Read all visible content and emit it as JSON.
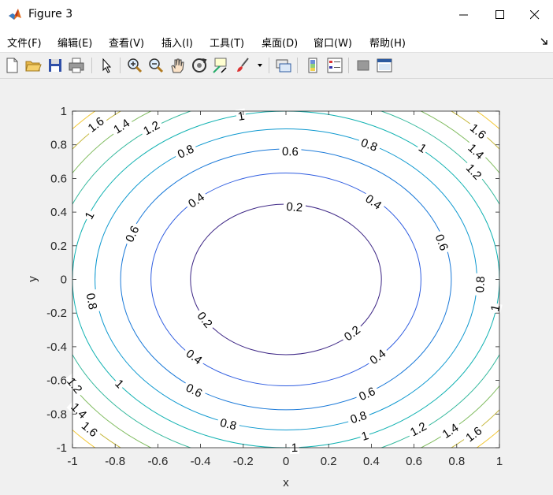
{
  "window": {
    "title": "Figure 3"
  },
  "menu": [
    {
      "label": "文件(F)",
      "name": "menu-file"
    },
    {
      "label": "编辑(E)",
      "name": "menu-edit"
    },
    {
      "label": "查看(V)",
      "name": "menu-view"
    },
    {
      "label": "插入(I)",
      "name": "menu-insert"
    },
    {
      "label": "工具(T)",
      "name": "menu-tools"
    },
    {
      "label": "桌面(D)",
      "name": "menu-desktop"
    },
    {
      "label": "窗口(W)",
      "name": "menu-window"
    },
    {
      "label": "帮助(H)",
      "name": "menu-help"
    }
  ],
  "toolbar": [
    {
      "icon": "new-figure-icon"
    },
    {
      "icon": "open-file-icon"
    },
    {
      "icon": "save-icon"
    },
    {
      "icon": "print-icon"
    },
    {
      "icon": "edit-plot-arrow-icon"
    },
    {
      "icon": "zoom-in-icon"
    },
    {
      "icon": "zoom-out-icon"
    },
    {
      "icon": "pan-hand-icon"
    },
    {
      "icon": "rotate-3d-icon"
    },
    {
      "icon": "data-cursor-icon"
    },
    {
      "icon": "brush-icon"
    },
    {
      "icon": "link-plot-icon"
    },
    {
      "icon": "insert-colorbar-icon"
    },
    {
      "icon": "insert-legend-icon"
    },
    {
      "icon": "hide-plot-tools-icon"
    },
    {
      "icon": "show-plot-tools-icon"
    }
  ],
  "chart_data": {
    "type": "contour",
    "function": "z = x^2 + y^2",
    "xlabel": "x",
    "ylabel": "y",
    "xlim": [
      -1,
      1
    ],
    "ylim": [
      -1,
      1
    ],
    "xticks": [
      "-1",
      "-0.8",
      "-0.6",
      "-0.4",
      "-0.2",
      "0",
      "0.2",
      "0.4",
      "0.6",
      "0.8",
      "1"
    ],
    "yticks": [
      "1",
      "0.8",
      "0.6",
      "0.4",
      "0.2",
      "0",
      "-0.2",
      "-0.4",
      "-0.6",
      "-0.8",
      "-1"
    ],
    "levels": [
      0.2,
      0.4,
      0.6,
      0.8,
      1,
      1.2,
      1.4,
      1.6,
      1.8
    ],
    "level_colors": [
      "#3d2685",
      "#2e5ce0",
      "#1a79d8",
      "#0c98cf",
      "#12b2b2",
      "#33b89c",
      "#7fbb5e",
      "#c5b73b",
      "#f2c630"
    ],
    "contour_labels": [
      {
        "text": "0.2",
        "x": 0.04,
        "y": 0.43
      },
      {
        "text": "0.2",
        "x": -0.38,
        "y": -0.24
      },
      {
        "text": "0.2",
        "x": 0.31,
        "y": -0.32
      },
      {
        "text": "0.4",
        "x": -0.42,
        "y": 0.47
      },
      {
        "text": "0.4",
        "x": 0.41,
        "y": 0.46
      },
      {
        "text": "0.4",
        "x": -0.43,
        "y": -0.46
      },
      {
        "text": "0.4",
        "x": 0.43,
        "y": -0.46
      },
      {
        "text": "0.6",
        "x": 0.02,
        "y": 0.76
      },
      {
        "text": "0.6",
        "x": -0.72,
        "y": 0.27
      },
      {
        "text": "0.6",
        "x": 0.73,
        "y": 0.22
      },
      {
        "text": "0.6",
        "x": -0.43,
        "y": -0.66
      },
      {
        "text": "0.6",
        "x": 0.38,
        "y": -0.68
      },
      {
        "text": "0.8",
        "x": -0.47,
        "y": 0.76
      },
      {
        "text": "0.8",
        "x": 0.39,
        "y": 0.8
      },
      {
        "text": "0.8",
        "x": 0.91,
        "y": -0.03
      },
      {
        "text": "0.8",
        "x": -0.91,
        "y": -0.13
      },
      {
        "text": "0.8",
        "x": -0.27,
        "y": -0.86
      },
      {
        "text": "0.8",
        "x": 0.34,
        "y": -0.82
      },
      {
        "text": "1",
        "x": -0.21,
        "y": 0.97
      },
      {
        "text": "1",
        "x": 0.64,
        "y": 0.78
      },
      {
        "text": "1",
        "x": -0.92,
        "y": 0.38
      },
      {
        "text": "1",
        "x": 0.98,
        "y": -0.17
      },
      {
        "text": "1",
        "x": -0.78,
        "y": -0.62
      },
      {
        "text": "1",
        "x": 0.37,
        "y": -0.93
      },
      {
        "text": "1",
        "x": 0.04,
        "y": -1.0
      },
      {
        "text": "1.2",
        "x": -0.63,
        "y": 0.9
      },
      {
        "text": "1.2",
        "x": 0.88,
        "y": 0.64
      },
      {
        "text": "1.2",
        "x": -0.99,
        "y": -0.63
      },
      {
        "text": "1.2",
        "x": 0.62,
        "y": -0.89
      },
      {
        "text": "1.4",
        "x": -0.77,
        "y": 0.91
      },
      {
        "text": "1.4",
        "x": 0.89,
        "y": 0.76
      },
      {
        "text": "1.4",
        "x": -0.97,
        "y": -0.78
      },
      {
        "text": "1.4",
        "x": 0.77,
        "y": -0.9
      },
      {
        "text": "1.6",
        "x": -0.89,
        "y": 0.92
      },
      {
        "text": "1.6",
        "x": 0.9,
        "y": 0.88
      },
      {
        "text": "1.6",
        "x": -0.92,
        "y": -0.89
      },
      {
        "text": "1.6",
        "x": 0.88,
        "y": -0.92
      }
    ]
  }
}
